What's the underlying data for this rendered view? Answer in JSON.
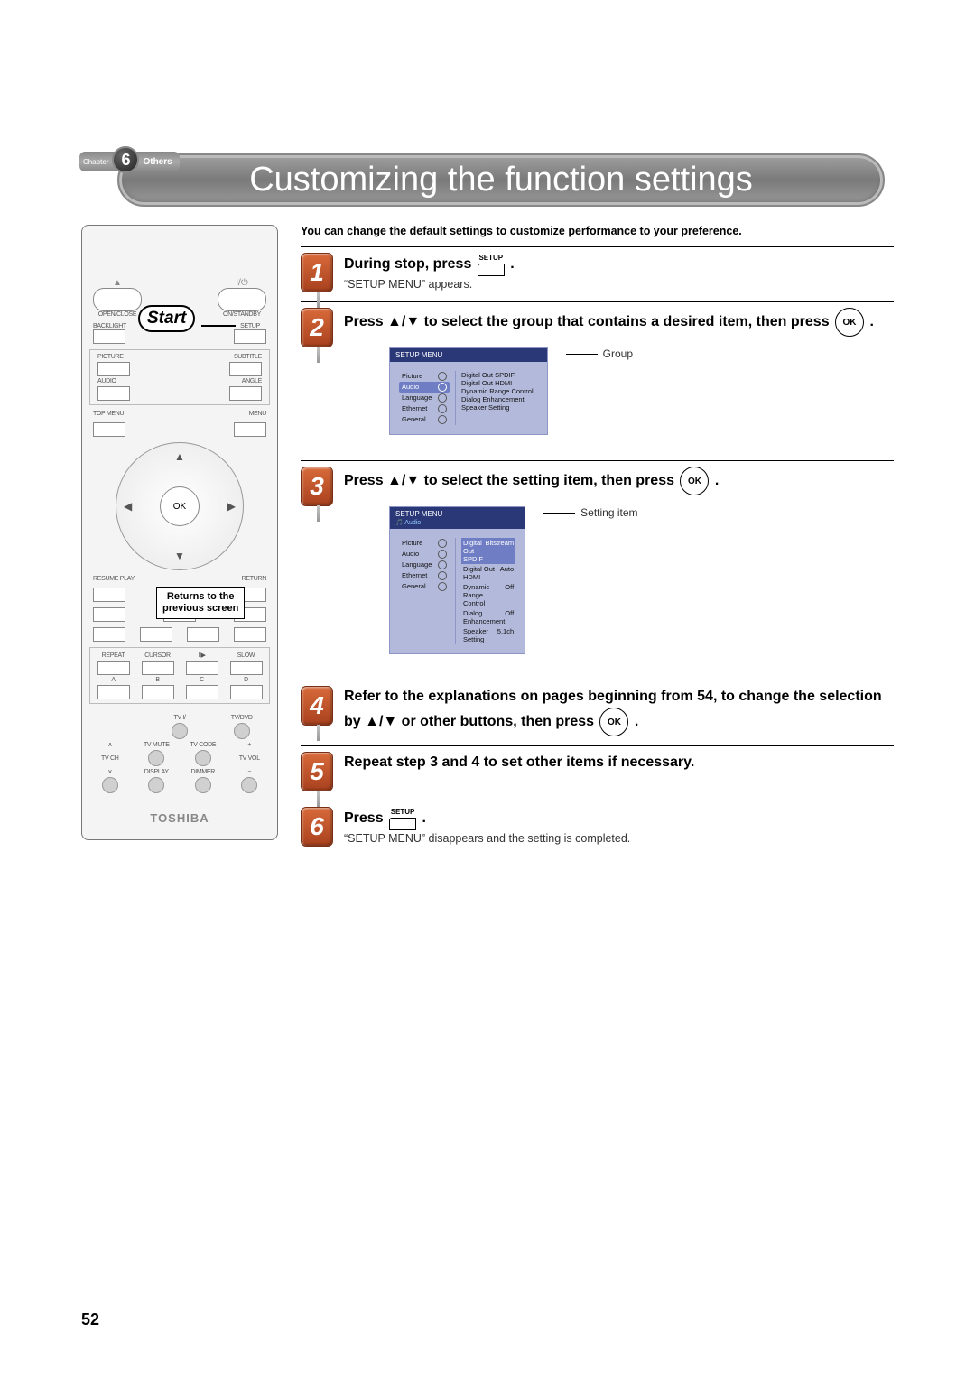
{
  "chapter": {
    "label": "Chapter",
    "number": "6",
    "section": "Others"
  },
  "title": "Customizing the function settings",
  "intro": "You can change the default settings to customize performance to your preference.",
  "remote": {
    "open": "OPEN/CLOSE",
    "standby": "ON/STANDBY",
    "backlight": "BACKLIGHT",
    "setup": "SETUP",
    "picture": "PICTURE",
    "subtitle": "SUBTITLE",
    "audio": "AUDIO",
    "angle": "ANGLE",
    "topmenu": "TOP MENU",
    "menu": "MENU",
    "ok": "OK",
    "resume": "RESUME PLAY",
    "return": "RETURN",
    "repeat": "REPEAT",
    "cursor": "CURSOR",
    "slow": "SLOW",
    "abcd": [
      "A",
      "B",
      "C",
      "D"
    ],
    "tvpwr": "TV I/ ",
    "tvdvd": "TV/DVD",
    "tvmute": "TV MUTE",
    "tvcode": "TV CODE",
    "tvch": "TV CH",
    "tvvol": "TV VOL",
    "display": "DISPLAY",
    "dimmer": "DIMMER",
    "brand": "TOSHIBA",
    "startBubble": "Start",
    "returnsBox_l1": "Returns to the",
    "returnsBox_l2": "previous screen"
  },
  "steps": {
    "s1": {
      "head_a": "During stop, press ",
      "head_b": ".",
      "sub": "“SETUP MENU” appears."
    },
    "s2": {
      "head_a": "Press ▲/▼ to select the group that contains a desired item, then press ",
      "head_b": ".",
      "callout": "Group",
      "osd_title": "SETUP MENU",
      "left": [
        "Picture",
        "Audio",
        "Language",
        "Ethernet",
        "General"
      ],
      "right": [
        "Digital Out SPDIF",
        "Digital Out HDMI",
        "Dynamic Range Control",
        "Dialog Enhancement",
        "Speaker Setting"
      ]
    },
    "s3": {
      "head_a": "Press ▲/▼ to select the setting item, then press ",
      "head_b": ".",
      "callout": "Setting item",
      "osd_title": "SETUP MENU",
      "osd_sub": "Audio",
      "left": [
        "Picture",
        "Audio",
        "Language",
        "Ethernet",
        "General"
      ],
      "right": [
        {
          "k": "Digital Out SPDIF",
          "v": "Bitstream"
        },
        {
          "k": "Digital Out HDMI",
          "v": "Auto"
        },
        {
          "k": "Dynamic Range Control",
          "v": "Off"
        },
        {
          "k": "Dialog Enhancement",
          "v": "Off"
        },
        {
          "k": "Speaker Setting",
          "v": "5.1ch"
        }
      ]
    },
    "s4": {
      "head": "Refer to the explanations on pages beginning from 54, to change the selection by ▲/▼ or other buttons, then press ",
      "tail": "."
    },
    "s5": {
      "head": "Repeat step 3 and 4 to set other items if necessary."
    },
    "s6": {
      "head_a": "Press ",
      "head_b": ".",
      "sub": "“SETUP MENU” disappears and the setting is completed."
    }
  },
  "pageNumber": "52"
}
